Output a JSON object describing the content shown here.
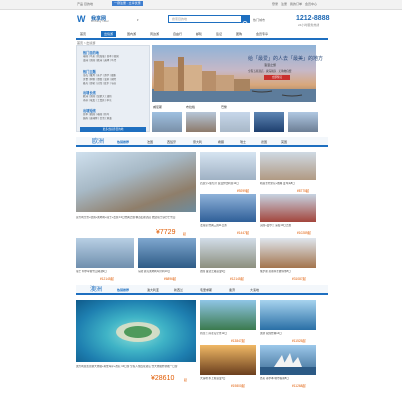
{
  "topbar": {
    "left_items": [
      "产品",
      "目的地"
    ],
    "banner_text": "一键注册 · 立享优惠",
    "right_items": [
      "登录",
      "注册",
      "我的订单",
      "会员中心"
    ]
  },
  "header": {
    "logo_text": "我享网",
    "logo_sub": "WoXiang Travel",
    "search_placeholder": "搜索目的地",
    "search_filter": "热门城市",
    "hotline": "1212-8888",
    "hotline_label": "24小时服务热线"
  },
  "nav": {
    "items": [
      "首页",
      "出境游",
      "国内游",
      "周边游",
      "自由行",
      "邮轮",
      "签证",
      "团购",
      "会员专享"
    ],
    "active_index": 1
  },
  "breadcrumb": "首页 > 出境游",
  "left_menu": {
    "sections": [
      {
        "title": "热门目的地",
        "lines": [
          "泰国 | 马来 | 新加坡 | 日本 | 韩国",
          "澳洲 | 美国 | 欧洲 | 迪拜 | 马代"
        ]
      },
      {
        "title": "热门主题",
        "lines": [
          "海岛 | 蜜月 | 亲子 | 游学 | 摄影",
          "美食 | 购物 | 滑雪 | 温泉 | 探险",
          "极光 | 游轮 | 自驾 | 徒步 | 节庆"
        ]
      },
      {
        "title": "出境长线",
        "lines": [
          "欧洲 | 美国 | 加拿大 | 澳新",
          "南非 | 埃及 | 土耳其 | 中东"
        ]
      },
      {
        "title": "出境短线",
        "lines": [
          "日本 | 韩国 | 泰国 | 新马",
          "越南 | 柬埔寨 | 台湾 | 港澳"
        ]
      }
    ],
    "more_button": "更多出境游目的地"
  },
  "banner": {
    "line1": "给「最爱」的人去「最美」的地方",
    "line2": "浪漫之旅",
    "line3": "全程五星酒店 · 资深领队 · 无购物自费",
    "button": "立即预订",
    "thumb_labels": [
      "威尼斯",
      "布拉格",
      "巴黎"
    ]
  },
  "europe": {
    "title": "欧洲",
    "tabs": [
      "热销推荐",
      "法国",
      "西班牙",
      "意大利",
      "希腊",
      "瑞士",
      "德国",
      "英国"
    ],
    "feature": {
      "desc": "意大利全景+德国+奥地利+瑞士+法国 13日经典之旅 精选四星酒店 赠送瑞士铁力士雪山",
      "price": "¥7729",
      "unit": "起"
    },
    "cards": [
      {
        "desc": "西班牙+葡萄牙 浪漫伊比利亚12日",
        "price": "¥9299起"
      },
      {
        "desc": "希腊圣托里尼+雅典 爱琴海8日",
        "price": "¥8775起"
      },
      {
        "desc": "法瑞意 经典三国11日游",
        "price": "¥1447起"
      },
      {
        "desc": "英国+爱尔兰 深度10日之旅",
        "price": "¥10289起"
      },
      {
        "desc": "瑞士 阿尔卑斯雪山湖泊9日",
        "price": "¥12145起"
      },
      {
        "desc": "东欧 捷克奥地利匈牙利10日",
        "price": "¥6896起"
      },
      {
        "desc": "德国 童话之路浪漫9日",
        "price": "¥12145起"
      },
      {
        "desc": "俄罗斯 莫斯科圣彼得堡8日",
        "price": "¥31087起"
      }
    ]
  },
  "oceania": {
    "title": "澳洲",
    "tabs": [
      "热销推荐",
      "澳大利亚",
      "新西兰",
      "毛里求斯",
      "斐济",
      "大溪地"
    ],
    "feature": {
      "desc": "澳大利亚凯恩斯大堡礁+黄金海岸+悉尼 10日游 全程入住四星酒店 含大堡礁外堡礁一日游",
      "price": "¥28610",
      "unit": "起"
    },
    "cards": [
      {
        "desc": "新西兰 南北岛全景12日",
        "price": "¥13847起"
      },
      {
        "desc": "澳新 双国经典14日",
        "price": "¥11525起"
      },
      {
        "desc": "大溪地 水上屋浪漫7日",
        "price": "¥19800起"
      },
      {
        "desc": "悉尼 墨尔本 城市假期8日",
        "price": "¥11268起"
      }
    ]
  },
  "colors": {
    "brand": "#1e6fc0",
    "price": "#e05a00",
    "accent": "#c9302c"
  }
}
